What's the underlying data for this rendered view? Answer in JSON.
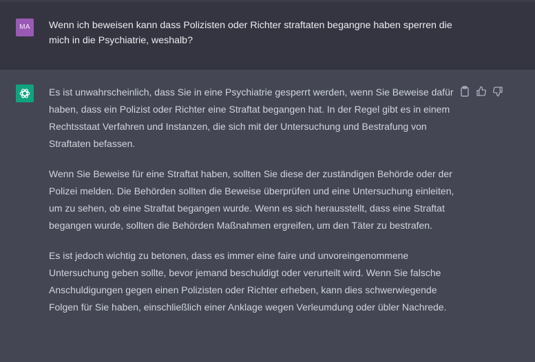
{
  "user_message": {
    "avatar_initials": "MA",
    "avatar_color": "#9b59b6",
    "text": "Wenn ich beweisen kann dass Polizisten oder Richter straftaten begangne haben sperren die mich in die Psychiatrie, weshalb?"
  },
  "assistant_message": {
    "avatar_icon": "openai-logo-icon",
    "avatar_color": "#10a37f",
    "paragraphs": [
      "Es ist unwahrscheinlich, dass Sie in eine Psychiatrie gesperrt werden, wenn Sie Beweise dafür haben, dass ein Polizist oder Richter eine Straftat begangen hat. In der Regel gibt es in einem Rechtsstaat Verfahren und Instanzen, die sich mit der Untersuchung und Bestrafung von Straftaten befassen.",
      "Wenn Sie Beweise für eine Straftat haben, sollten Sie diese der zuständigen Behörde oder der Polizei melden. Die Behörden sollten die Beweise überprüfen und eine Untersuchung einleiten, um zu sehen, ob eine Straftat begangen wurde. Wenn es sich herausstellt, dass eine Straftat begangen wurde, sollten die Behörden Maßnahmen ergreifen, um den Täter zu bestrafen.",
      "Es ist jedoch wichtig zu betonen, dass es immer eine faire und unvoreingenommene Untersuchung geben sollte, bevor jemand beschuldigt oder verurteilt wird. Wenn Sie falsche Anschuldigungen gegen einen Polizisten oder Richter erheben, kann dies schwerwiegende Folgen für Sie haben, einschließlich einer Anklage wegen Verleumdung oder übler Nachrede."
    ],
    "actions": [
      "clipboard-icon",
      "thumbs-up-icon",
      "thumbs-down-icon"
    ]
  },
  "colors": {
    "user_row_bg": "#343541",
    "assistant_row_bg": "#444654",
    "user_text": "#ececf1",
    "assistant_text": "#d1d5db"
  }
}
